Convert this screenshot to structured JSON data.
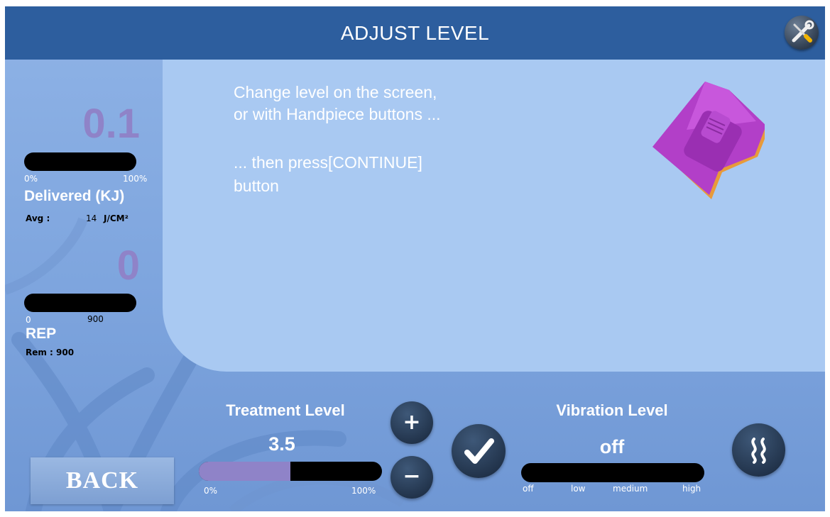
{
  "header": {
    "title": "ADJUST LEVEL",
    "tools_icon": "wrench-screwdriver-icon"
  },
  "instructions": {
    "line1": "Change level on the screen,",
    "line2": "or with Handpiece buttons ...",
    "line3": "... then press[CONTINUE]",
    "line4": "button"
  },
  "delivered": {
    "value": "0.1",
    "bar_min": "0%",
    "bar_max": "100%",
    "label": "Delivered (KJ)",
    "avg_label": "Avg :",
    "avg_value": "14",
    "avg_unit": "J/CM²"
  },
  "rep": {
    "value": "0",
    "bar_min": "0",
    "bar_max": "900",
    "label": "REP",
    "remaining": "Rem : 900"
  },
  "treatment": {
    "title": "Treatment Level",
    "value": "3.5",
    "fill_fraction": 0.5,
    "bar_min": "0%",
    "bar_max": "100%",
    "plus_label": "+",
    "minus_label": "−"
  },
  "confirm_icon": "check-icon",
  "vibration": {
    "title": "Vibration Level",
    "value": "off",
    "ticks": [
      "off",
      "low",
      "medium",
      "high"
    ],
    "icon": "vibration-icon"
  },
  "back_label": "BACK",
  "colors": {
    "header": "#2d5e9e",
    "accent": "#8f83c8",
    "panel": "#a9c9f2"
  }
}
